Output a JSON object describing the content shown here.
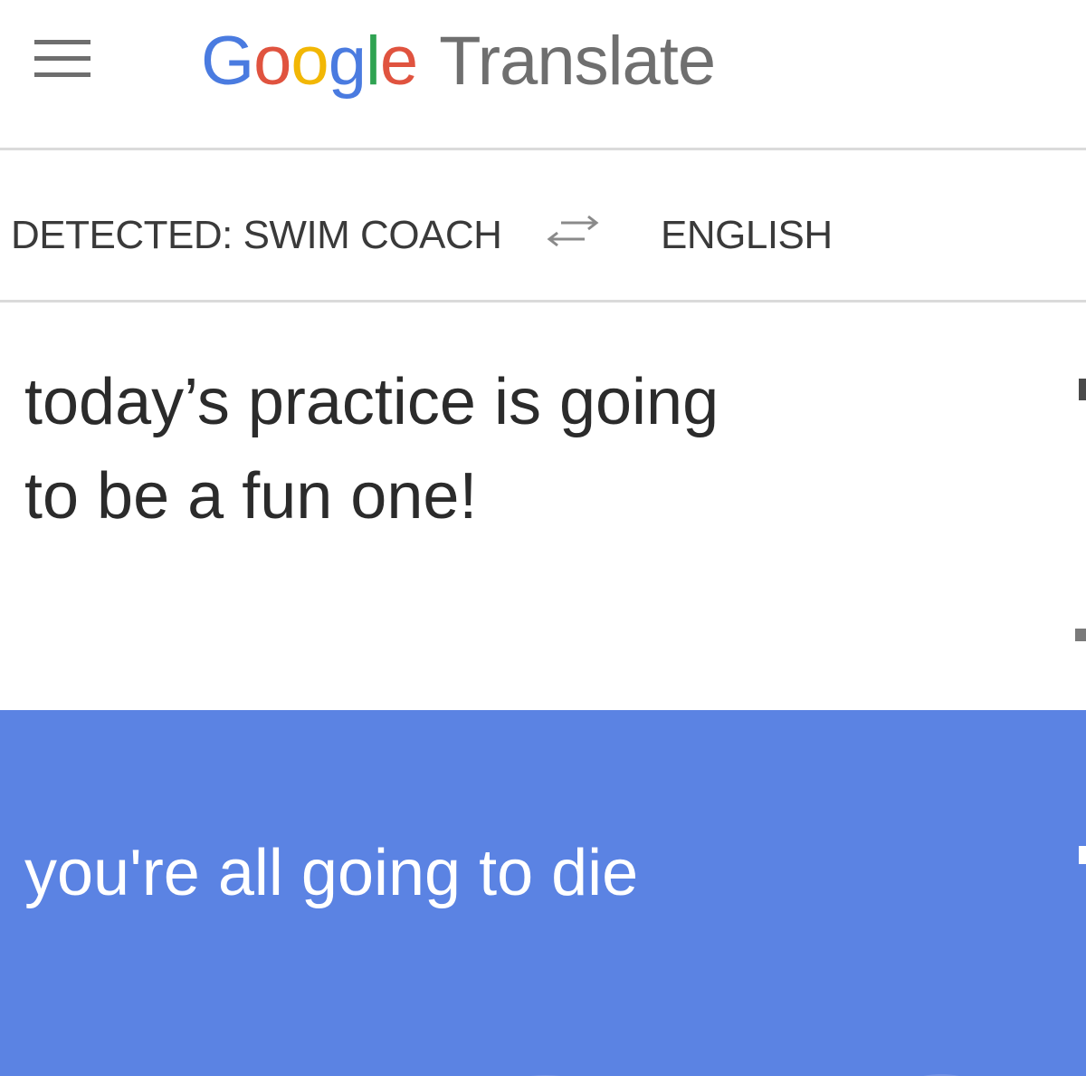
{
  "header": {
    "menu_icon": "hamburger-menu-icon",
    "brand": {
      "letters": [
        {
          "char": "G",
          "color": "#4a7be0"
        },
        {
          "char": "o",
          "color": "#e0533f"
        },
        {
          "char": "o",
          "color": "#f2b705"
        },
        {
          "char": "g",
          "color": "#4a7be0"
        },
        {
          "char": "l",
          "color": "#2fa352"
        },
        {
          "char": "e",
          "color": "#e0533f"
        }
      ],
      "product": "Translate"
    }
  },
  "languages": {
    "source": "DETECTED: SWIM COACH",
    "target": "ENGLISH",
    "swap_icon": "swap-arrows-icon"
  },
  "source": {
    "text": "today’s practice is going\nto be a fun one!"
  },
  "translation": {
    "text": "you're all going to die",
    "background": "#5b83e3"
  }
}
